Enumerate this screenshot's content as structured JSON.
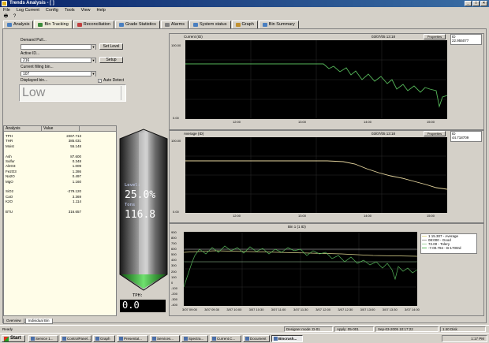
{
  "window": {
    "title": "Trends Analysis - [ ]",
    "menu": [
      "File",
      "Log Current",
      "Config",
      "Tools",
      "View",
      "Help"
    ]
  },
  "tabs": [
    {
      "label": "Analysis",
      "color": "#4a7fc0"
    },
    {
      "label": "Bin Tracking",
      "color": "#3a8a3a",
      "active": true
    },
    {
      "label": "Reconciliation",
      "color": "#c04040"
    },
    {
      "label": "Grade Statistics",
      "color": "#4a7fc0"
    },
    {
      "label": "Alarms",
      "color": "#808080"
    },
    {
      "label": "System status",
      "color": "#4a7fc0"
    },
    {
      "label": "Graph",
      "color": "#c09030"
    },
    {
      "label": "Bin Summary",
      "color": "#4a7fc0"
    }
  ],
  "left_panel": {
    "field1_label": "Demand Pull...",
    "field1_value": "",
    "field1_button": "Set Level",
    "field2_label": "Active ID...",
    "field2_value": "216",
    "field2_button": "Setup",
    "field3_label": "Current filling bin...",
    "field3_value": "107",
    "field4_label": "Displayed bin...",
    "auto_detect_label": "Auto Detect",
    "status_value": "Low"
  },
  "analysis": {
    "headers": [
      "Analysis",
      "Value"
    ],
    "rows": [
      {
        "name": "TPH",
        "value": "2267.713"
      },
      {
        "name": "THR",
        "value": "385.031"
      },
      {
        "name": "Moist",
        "value": "55.148"
      },
      {
        "name": "",
        "value": ""
      },
      {
        "name": "Ash",
        "value": "87.600"
      },
      {
        "name": "Sulfur",
        "value": "0.348"
      },
      {
        "name": "Al2O3",
        "value": "1.009"
      },
      {
        "name": "Fe2O3",
        "value": "1.286"
      },
      {
        "name": "Na2O",
        "value": "0.497"
      },
      {
        "name": "MgO",
        "value": "1.160"
      },
      {
        "name": "",
        "value": ""
      },
      {
        "name": "SiO2",
        "value": "-279.120"
      },
      {
        "name": "CaO",
        "value": "3.369"
      },
      {
        "name": "K2O",
        "value": "1.114"
      },
      {
        "name": "",
        "value": ""
      },
      {
        "name": "BTU",
        "value": "316.657"
      }
    ]
  },
  "gauge": {
    "level_label": "Level:",
    "level_value": "25.0%",
    "tons_label": "Tons",
    "tons_value": "116.8",
    "tph_label": "TPH:",
    "tph_value": "0.0",
    "fill_fraction": 0.25,
    "fill_color": "#2fbf2f"
  },
  "charts": {
    "top": {
      "title": "Current (ID)",
      "timestamp": "03/07/05 13:18",
      "button": "Properties",
      "side_label": "ID",
      "side_value": "22.955077",
      "y_labels": [
        "100.00",
        "0.00"
      ],
      "x_labels": [
        "12:00",
        "13:00",
        "14:00",
        "15:00"
      ],
      "line_color": "#56b85a"
    },
    "middle": {
      "title": "Average (ID)",
      "timestamp": "03/07/05 13:18",
      "button": "Properties",
      "side_label": "ID",
      "side_value": "44.718709",
      "y_labels": [
        "100.00",
        "0.00"
      ],
      "x_labels": [
        "12:00",
        "13:00",
        "14:00",
        "15:00"
      ],
      "line_color": "#e8d8a0"
    },
    "bottom": {
      "title": "Bin 1 (1 ID)",
      "y_labels": [
        "900",
        "800",
        "700",
        "600",
        "500",
        "400",
        "300",
        "200",
        "100",
        "0",
        "-100",
        "-200",
        "-300",
        "-400"
      ],
      "x_labels": [
        "3/07 09:00",
        "3/07 09:30",
        "3/07 10:00",
        "3/07 10:30",
        "3/07 11:00",
        "3/07 11:30",
        "3/07 12:00",
        "3/07 12:30",
        "3/07 13:00",
        "3/07 13:30",
        "3/07 14:00"
      ],
      "legend": [
        {
          "label": "1 15.307 - Average",
          "color": "#e0d890"
        },
        {
          "label": "08:000 - Good",
          "color": "#ffffff"
        },
        {
          "label": "72.00 - Tolery",
          "color": "#a0d0a0"
        },
        {
          "label": "-7.00.794 - B-1700rd",
          "color": "#56b85a"
        }
      ],
      "line_color": "#56b85a"
    }
  },
  "bottom_tabs": [
    "Overview",
    "Individual Bin"
  ],
  "statusbar": {
    "left": "Ready",
    "cells": [
      "Designer mode: D-01",
      "Apply: 05-001",
      "Sep-03-2005  10:17:22",
      "1:40   Disk"
    ]
  },
  "taskbar": {
    "start_label": "Start",
    "items": [
      "Service 1...",
      "ControlPanel...",
      "Graph",
      "Presentat...",
      "Services...",
      "Spectra...",
      "Current.C...",
      "Document",
      "Bincrush..."
    ],
    "clock": "1:17 PM"
  }
}
